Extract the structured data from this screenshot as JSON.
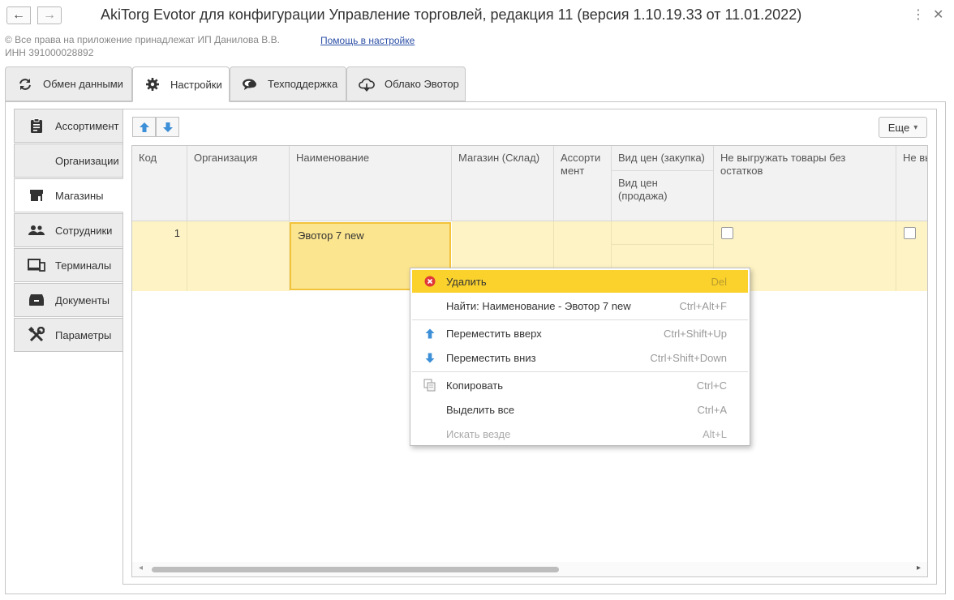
{
  "window": {
    "title": "AkiTorg Evotor для конфигурации Управление торговлей, редакция 11 (версия 1.10.19.33 от 11.01.2022)",
    "back_glyph": "←",
    "forward_glyph": "→",
    "more_glyph": "⋮",
    "close_glyph": "✕"
  },
  "header": {
    "copyright": "© Все права на приложение принадлежат ИП Данилова В.В.",
    "inn": "ИНН 391000028892",
    "help_link": "Помощь в настройке"
  },
  "top_tabs": [
    {
      "label": "Обмен данными",
      "icon": "sync-icon"
    },
    {
      "label": "Настройки",
      "icon": "gear-icon",
      "active": true
    },
    {
      "label": "Техподдержка",
      "icon": "chat-icon"
    },
    {
      "label": "Облако Эвотор",
      "icon": "cloud-icon"
    }
  ],
  "side_tabs": [
    {
      "label": "Ассортимент",
      "icon": "clipboard-icon"
    },
    {
      "label": "Организации",
      "icon": ""
    },
    {
      "label": "Магазины",
      "icon": "store-icon",
      "active": true
    },
    {
      "label": "Сотрудники",
      "icon": "people-icon"
    },
    {
      "label": "Терминалы",
      "icon": "terminal-icon"
    },
    {
      "label": "Документы",
      "icon": "box-icon"
    },
    {
      "label": "Параметры",
      "icon": "tools-icon"
    }
  ],
  "toolbar": {
    "more_label": "Еще",
    "more_arrow": "▾"
  },
  "table": {
    "columns": {
      "code": "Код",
      "org": "Организация",
      "name": "Наименование",
      "store": "Магазин (Склад)",
      "assortment": "Ассорти мент",
      "price_purchase": "Вид цен (закупка)",
      "price_sale": "Вид цен (продажа)",
      "no_unload": "Не выгружать товары без остатков",
      "extra": "Не вы"
    },
    "rows": [
      {
        "code": "1",
        "org": "",
        "name": "Эвотор 7 new",
        "store": "",
        "assortment": "",
        "price_purchase": "",
        "price_sale": "",
        "no_unload": false,
        "extra": false
      }
    ]
  },
  "context_menu": {
    "items": [
      {
        "label": "Удалить",
        "shortcut": "Del",
        "icon": "delete-icon",
        "highlighted": true
      },
      {
        "label": "Найти: Наименование - Эвотор 7 new",
        "shortcut": "Ctrl+Alt+F"
      },
      {
        "label": "Переместить вверх",
        "shortcut": "Ctrl+Shift+Up",
        "icon": "arrow-up-icon"
      },
      {
        "label": "Переместить вниз",
        "shortcut": "Ctrl+Shift+Down",
        "icon": "arrow-down-icon"
      },
      {
        "label": "Копировать",
        "shortcut": "Ctrl+C",
        "icon": "copy-icon"
      },
      {
        "label": "Выделить все",
        "shortcut": "Ctrl+A"
      },
      {
        "label": "Искать везде",
        "shortcut": "Alt+L",
        "disabled": true
      }
    ]
  },
  "colors": {
    "accent_yellow": "#fbd22c",
    "row_selected": "#fdf3c4",
    "cell_selected": "#fce58f",
    "arrow_blue": "#3d8fd8",
    "delete_red": "#e03838",
    "link_blue": "#2c4fa6"
  },
  "scroll": {
    "left_arrow": "◂",
    "right_arrow": "▸"
  }
}
